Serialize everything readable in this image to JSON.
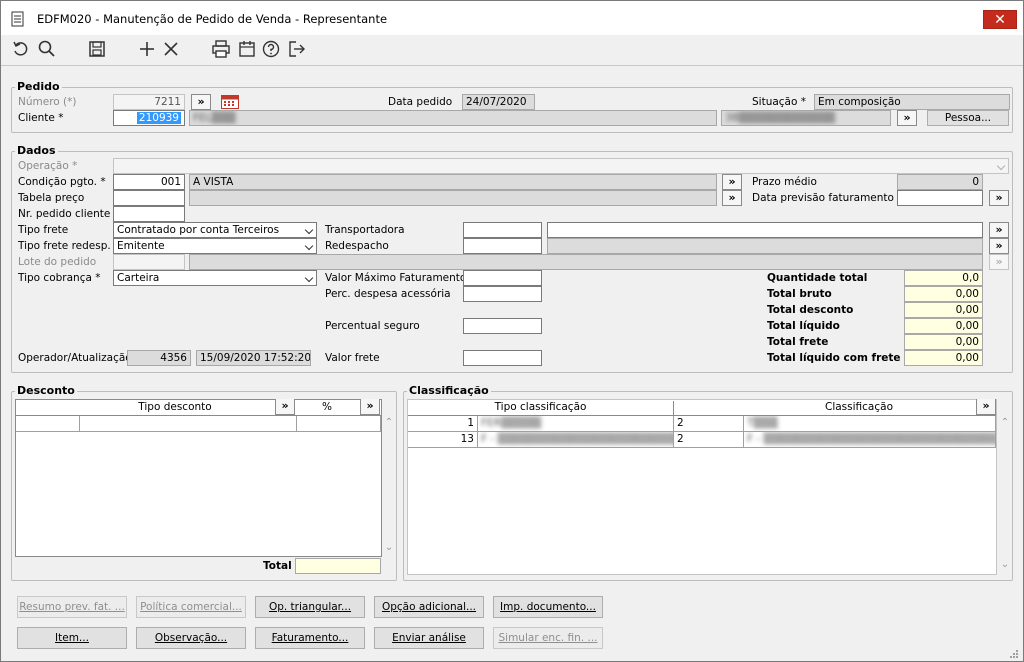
{
  "window": {
    "title": "EDFM020 - Manutenção de Pedido de Venda - Representante",
    "close": "✕"
  },
  "toolbar": {
    "icons": [
      "undo-icon",
      "search-icon",
      "save-icon",
      "add-icon",
      "delete-icon",
      "print-icon",
      "calendar-icon",
      "help-icon",
      "exit-icon"
    ]
  },
  "pedido": {
    "group_label": "Pedido",
    "numero_label": "Número (*)",
    "numero_value": "7211",
    "data_pedido_label": "Data pedido",
    "data_pedido_value": "24/07/2020",
    "situacao_label": "Situação *",
    "situacao_value": "Em composição",
    "cliente_label": "Cliente *",
    "cliente_code": "210939",
    "cliente_name": "FEL▒▒▒",
    "cliente_doc": "38▒▒▒▒▒▒▒▒▒▒▒▒",
    "pessoa_button": "Pessoa..."
  },
  "dados": {
    "group_label": "Dados",
    "operacao_label": "Operação *",
    "condicao_label": "Condição pgto. *",
    "condicao_code": "001",
    "condicao_desc": "A VISTA",
    "prazo_medio_label": "Prazo médio",
    "prazo_medio_value": "0",
    "tabela_preco_label": "Tabela preço",
    "data_previsao_label": "Data previsão faturamento",
    "nr_pedido_cliente_label": "Nr. pedido cliente",
    "tipo_frete_label": "Tipo frete",
    "tipo_frete_value": "Contratado por conta Terceiros",
    "transportadora_label": "Transportadora",
    "tipo_frete_redesp_label": "Tipo frete redesp.",
    "tipo_frete_redesp_value": "Emitente",
    "redespacho_label": "Redespacho",
    "lote_pedido_label": "Lote do pedido",
    "tipo_cobranca_label": "Tipo cobrança *",
    "tipo_cobranca_value": "Carteira",
    "valor_maximo_label": "Valor Máximo Faturamento",
    "perc_despesa_label": "Perc. despesa acessória",
    "percentual_seguro_label": "Percentual seguro",
    "operador_label": "Operador/Atualização",
    "operador_value": "4356",
    "atualizacao_value": "15/09/2020 17:52:20",
    "valor_frete_label": "Valor frete"
  },
  "totals": [
    {
      "label": "Quantidade total",
      "value": "0,0"
    },
    {
      "label": "Total bruto",
      "value": "0,00"
    },
    {
      "label": "Total desconto",
      "value": "0,00"
    },
    {
      "label": "Total líquido",
      "value": "0,00"
    },
    {
      "label": "Total frete",
      "value": "0,00"
    },
    {
      "label": "Total líquido com frete",
      "value": "0,00"
    }
  ],
  "desconto": {
    "group_label": "Desconto",
    "col_tipo": "Tipo desconto",
    "col_pct": "%",
    "total_label": "Total"
  },
  "classificacao": {
    "group_label": "Classificação",
    "col_tipo": "Tipo classificação",
    "col_class": "Classificação",
    "rows": [
      {
        "num": "1",
        "tipo": "FER▒▒▒▒▒",
        "code": "2",
        "class": "T▒▒▒"
      },
      {
        "num": "13",
        "tipo": "F - ▒▒▒▒▒▒▒▒▒▒▒▒▒▒▒▒▒▒▒▒▒▒▒▒▒▒▒",
        "code": "2",
        "class": "F - ▒▒▒▒▒▒▒▒▒▒▒▒▒▒▒▒▒▒▒▒▒▒▒▒▒▒▒▒▒"
      }
    ]
  },
  "buttons_row1": [
    {
      "label": "Resumo prev. fat. ...",
      "enabled": false
    },
    {
      "label": "Política comercial...",
      "enabled": false
    },
    {
      "label": "Op. triangular...",
      "enabled": true
    },
    {
      "label": "Opção adicional...",
      "enabled": true
    },
    {
      "label": "Imp. documento...",
      "enabled": true
    }
  ],
  "buttons_row2": [
    {
      "label": "Item...",
      "enabled": true
    },
    {
      "label": "Observação...",
      "enabled": true
    },
    {
      "label": "Faturamento...",
      "enabled": true
    },
    {
      "label": "Enviar análise",
      "enabled": true
    },
    {
      "label": "Simular enc. fin. ...",
      "enabled": false
    }
  ],
  "lookup_glyph": "»"
}
